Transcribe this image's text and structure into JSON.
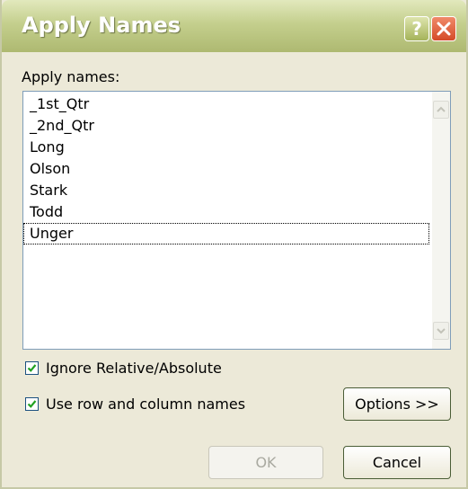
{
  "window": {
    "title": "Apply Names",
    "help_glyph": "?",
    "close_icon": "close-icon"
  },
  "apply_names_label": "Apply names:",
  "names_list": [
    {
      "label": "_1st_Qtr"
    },
    {
      "label": "_2nd_Qtr"
    },
    {
      "label": "Long"
    },
    {
      "label": "Olson"
    },
    {
      "label": "Stark"
    },
    {
      "label": "Todd"
    },
    {
      "label": "Unger",
      "focused": true
    }
  ],
  "options": {
    "ignore_relative_absolute": {
      "label": "Ignore Relative/Absolute",
      "checked": true
    },
    "use_row_column_names": {
      "label": "Use row and column names",
      "checked": true
    }
  },
  "buttons": {
    "options": "Options >>",
    "ok": "OK",
    "cancel": "Cancel"
  },
  "colors": {
    "titlebar": "#c4cf8d",
    "dialog_bg": "#ece9d8",
    "close_button": "#d44b27",
    "check_mark": "#21a121"
  }
}
